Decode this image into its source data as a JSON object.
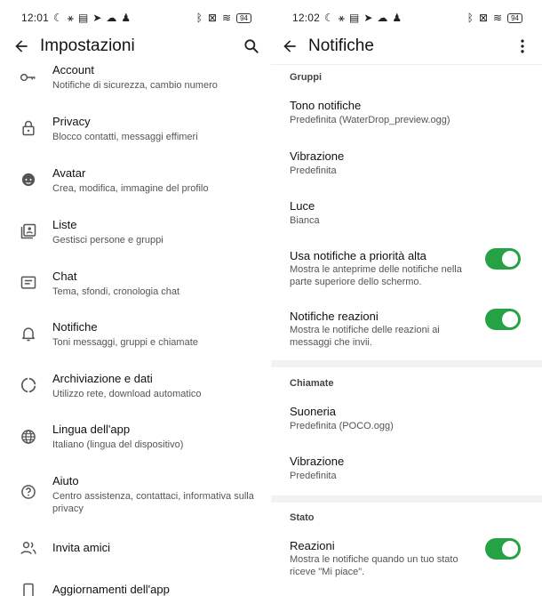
{
  "left_screen": {
    "status": {
      "time": "12:01",
      "battery": "94"
    },
    "appbar": {
      "title": "Impostazioni"
    },
    "items": [
      {
        "title": "Account",
        "subtitle": "Notifiche di sicurezza, cambio numero"
      },
      {
        "title": "Privacy",
        "subtitle": "Blocco contatti, messaggi effimeri"
      },
      {
        "title": "Avatar",
        "subtitle": "Crea, modifica, immagine del profilo"
      },
      {
        "title": "Liste",
        "subtitle": "Gestisci persone e gruppi"
      },
      {
        "title": "Chat",
        "subtitle": "Tema, sfondi, cronologia chat"
      },
      {
        "title": "Notifiche",
        "subtitle": "Toni messaggi, gruppi e chiamate"
      },
      {
        "title": "Archiviazione e dati",
        "subtitle": "Utilizzo rete, download automatico"
      },
      {
        "title": "Lingua dell'app",
        "subtitle": "Italiano (lingua del dispositivo)"
      },
      {
        "title": "Aiuto",
        "subtitle": "Centro assistenza, contattaci, informativa sulla privacy"
      },
      {
        "title": "Invita amici",
        "subtitle": ""
      },
      {
        "title": "Aggiornamenti dell'app",
        "subtitle": ""
      }
    ]
  },
  "right_screen": {
    "status": {
      "time": "12:02",
      "battery": "94"
    },
    "appbar": {
      "title": "Notifiche"
    },
    "sections": {
      "gruppi": "Gruppi",
      "chiamate": "Chiamate",
      "stato": "Stato"
    },
    "items": {
      "tono": {
        "title": "Tono notifiche",
        "subtitle": "Predefinita (WaterDrop_preview.ogg)"
      },
      "vibrazione": {
        "title": "Vibrazione",
        "subtitle": "Predefinita"
      },
      "luce": {
        "title": "Luce",
        "subtitle": "Bianca"
      },
      "priorita": {
        "title": "Usa notifiche a priorità alta",
        "subtitle": "Mostra le anteprime delle notifiche nella parte superiore dello schermo."
      },
      "reazioni": {
        "title": "Notifiche reazioni",
        "subtitle": "Mostra le notifiche delle reazioni ai messaggi che invii."
      },
      "suoneria": {
        "title": "Suoneria",
        "subtitle": "Predefinita (POCO.ogg)"
      },
      "vibrazione_chiamate": {
        "title": "Vibrazione",
        "subtitle": "Predefinita"
      },
      "reazioni_stato": {
        "title": "Reazioni",
        "subtitle": "Mostra le notifiche quando un tuo stato riceve \"Mi piace\"."
      }
    },
    "toggles": {
      "priorita": true,
      "reazioni": true,
      "reazioni_stato": true
    }
  },
  "colors": {
    "toggle_on": "#25a244",
    "divider": "#f2f2f2"
  },
  "icons": [
    "key-icon",
    "lock-icon",
    "avatar-face-icon",
    "list-icon",
    "chat-icon",
    "bell-icon",
    "storage-icon",
    "globe-icon",
    "help-icon",
    "people-icon",
    "update-icon"
  ]
}
